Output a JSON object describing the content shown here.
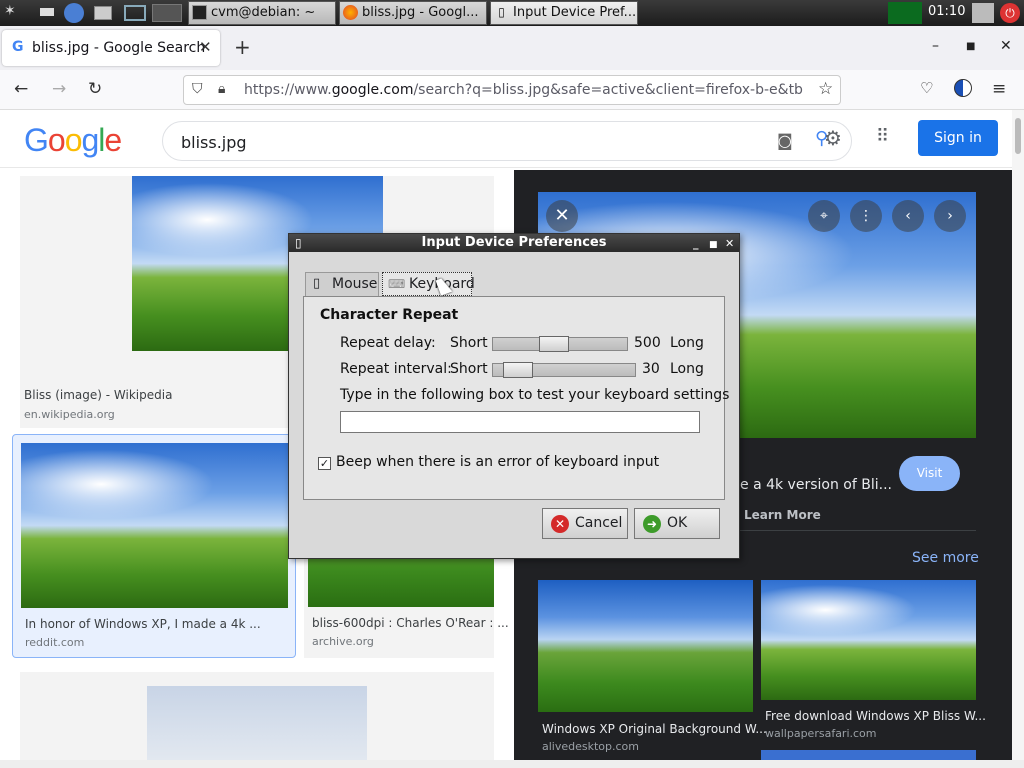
{
  "taskbar": {
    "tasks": [
      {
        "label": "cvm@debian: ~"
      },
      {
        "label": "bliss.jpg - Googl..."
      },
      {
        "label": "Input Device Pref..."
      }
    ],
    "clock": "01:10"
  },
  "browser": {
    "tab_title": "bliss.jpg - Google Search",
    "tab_favicon": "G",
    "url_prefix": "https://www.",
    "url_host": "google.com",
    "url_rest": "/search?q=bliss.jpg&safe=active&client=firefox-b-e&tbm"
  },
  "google": {
    "logo": [
      "G",
      "o",
      "o",
      "g",
      "l",
      "e"
    ],
    "logo_colors": [
      "#4285f4",
      "#ea4335",
      "#fbbc05",
      "#4285f4",
      "#34a853",
      "#ea4335"
    ],
    "query": "bliss.jpg",
    "signin": "Sign in",
    "results": [
      {
        "title": "Bliss (image) - Wikipedia",
        "site": "en.wikipedia.org"
      },
      {
        "title": "In honor of Windows XP, I made a 4k ...",
        "site": "reddit.com"
      },
      {
        "title": "bliss-600dpi : Charles O'Rear : ...",
        "site": "archive.org"
      }
    ],
    "panel": {
      "desc": "e a 4k version of Bli...",
      "visit": "Visit",
      "learn_more": "Learn More",
      "see_more": "See more",
      "related": [
        {
          "title": "Windows XP Original Background W...",
          "site": "alivedesktop.com"
        },
        {
          "title": "Free download Windows XP Bliss W...",
          "site": "wallpapersafari.com"
        }
      ]
    }
  },
  "dialog": {
    "title": "Input Device Preferences",
    "tabs": [
      "Mouse",
      "Keyboard"
    ],
    "section": "Character Repeat",
    "delay_label": "Repeat delay:",
    "interval_label": "Repeat interval:",
    "short": "Short",
    "long": "Long",
    "delay_value": "500",
    "interval_value": "30",
    "test_prompt": "Type in the following box to test your keyboard settings",
    "test_value": "",
    "beep_label": "Beep when there is an error of keyboard input",
    "beep_checked": true,
    "cancel": "Cancel",
    "ok": "OK"
  }
}
